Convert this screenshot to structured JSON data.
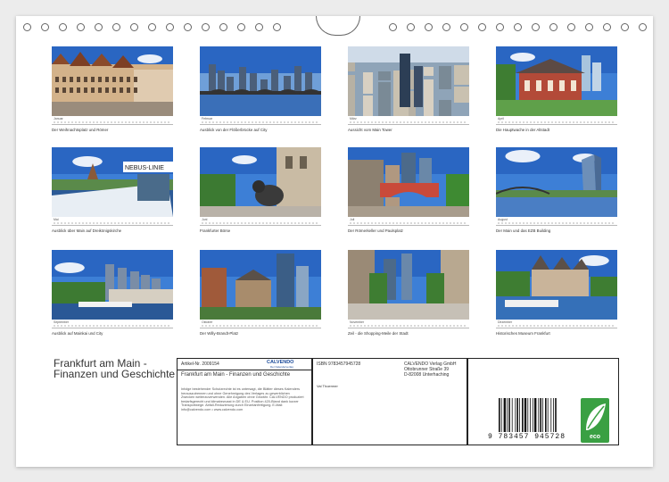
{
  "calendar": {
    "title": "Frankfurt am Main - Finanzen und Geschichte",
    "months": [
      {
        "month": "Januar",
        "caption": "Der Weihnachtsplatz und Römer"
      },
      {
        "month": "Februar",
        "caption": "Ausblick von der Flößerbrücke auf City"
      },
      {
        "month": "März",
        "caption": "Aussicht vom Main Tower"
      },
      {
        "month": "April",
        "caption": "Die Hauptwache in der Altstadt"
      },
      {
        "month": "Mai",
        "caption": "Ausblick über Main auf Dreikönigskirche"
      },
      {
        "month": "Juni",
        "caption": "Frankfurter Börse"
      },
      {
        "month": "Juli",
        "caption": "Der Römerkeller und Paulsplatz"
      },
      {
        "month": "August",
        "caption": "Der Main und das EZB Building"
      },
      {
        "month": "September",
        "caption": "Ausblick auf Mainkai und City"
      },
      {
        "month": "Oktober",
        "caption": "Der Willy-Brandt-Platz"
      },
      {
        "month": "November",
        "caption": "Zeil - die Shopping-Meile der Stadt"
      },
      {
        "month": "Dezember",
        "caption": "Historisches Museum Frankfurt"
      }
    ],
    "boat_sign": "NEBUS-LINIE"
  },
  "info": {
    "article": "Artikel-Nr. 2009154",
    "brand": "CALVENDO",
    "brand_sub": "Der Kalenderverlag",
    "product_title": "Frankfurt am Main - Finanzen und Geschichte",
    "description": "Infolge bestehender Schutzrechte ist es untersagt, die Blätter dieses Kalenders herauszutrennen und ohne Genehmigung des Verlages zu gewerblichen Zwecken weiterzuverwenden. Alle Angaben ohne Gewähr. CALVENDO produziert bedarfsgerecht und klimabewusst in DE & EU. Position 420-Bland dank kurzer Transportwege. Abfall-Reduzierung durch Einzelanfertigung. E-Mail: info@calvendo.com • www.calvendo.com",
    "isbn": "ISBN 9783457945728",
    "author": "Val Thoermer",
    "publisher_lines": [
      "CALVENDO Verlag GmbH",
      "Ottobrunner Straße 39",
      "D-82008 Unterhaching"
    ],
    "barcode_digits": "9 783457 945728",
    "eco_label": "eco"
  },
  "colors": {
    "sky": "#3d7fd6",
    "frame": "#222222",
    "eco_green": "#3aa043",
    "calvendo_blue": "#1a4a9a"
  }
}
